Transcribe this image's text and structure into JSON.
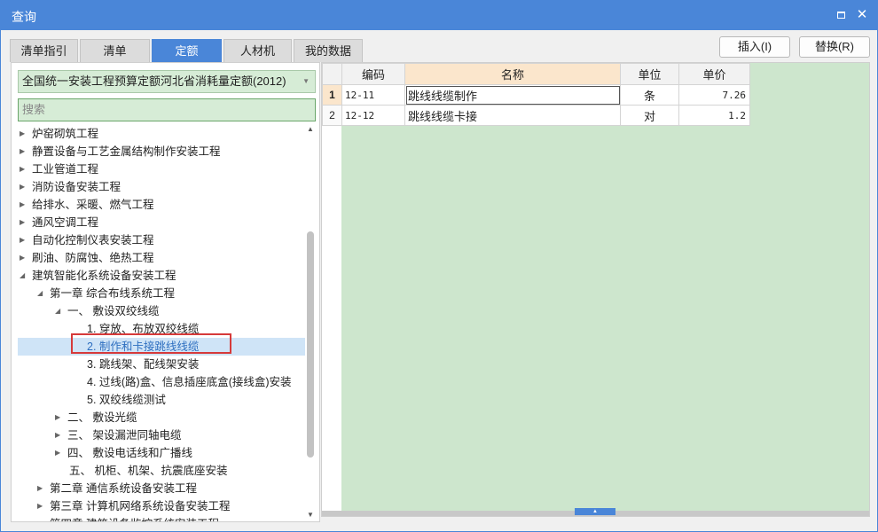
{
  "window": {
    "title": "查询",
    "maximize_icon": "maximize-icon",
    "close_icon": "close-icon"
  },
  "tabs": [
    {
      "label": "清单指引",
      "active": false
    },
    {
      "label": "清单",
      "active": false
    },
    {
      "label": "定额",
      "active": true
    },
    {
      "label": "人材机",
      "active": false
    },
    {
      "label": "我的数据",
      "active": false
    }
  ],
  "actions": {
    "insert": "插入(I)",
    "replace": "替换(R)"
  },
  "left": {
    "library": "全国统一安装工程预算定额河北省消耗量定额(2012)",
    "search_placeholder": "搜索",
    "tree": [
      {
        "label": "炉窑砌筑工程",
        "toggle": "▶"
      },
      {
        "label": "静置设备与工艺金属结构制作安装工程",
        "toggle": "▶"
      },
      {
        "label": "工业管道工程",
        "toggle": "▶"
      },
      {
        "label": "消防设备安装工程",
        "toggle": "▶"
      },
      {
        "label": "给排水、采暖、燃气工程",
        "toggle": "▶"
      },
      {
        "label": "通风空调工程",
        "toggle": "▶"
      },
      {
        "label": "自动化控制仪表安装工程",
        "toggle": "▶"
      },
      {
        "label": "刷油、防腐蚀、绝热工程",
        "toggle": "▶"
      },
      {
        "label": "建筑智能化系统设备安装工程",
        "toggle": "◢"
      },
      {
        "label": "第一章 综合布线系统工程",
        "toggle": "◢"
      },
      {
        "label": "一、 敷设双绞线缆",
        "toggle": "◢"
      },
      {
        "label": "1. 穿放、布放双绞线缆",
        "toggle": ""
      },
      {
        "label": "2. 制作和卡接跳线线缆",
        "toggle": ""
      },
      {
        "label": "3. 跳线架、配线架安装",
        "toggle": ""
      },
      {
        "label": "4. 过线(路)盒、信息插座底盒(接线盒)安装",
        "toggle": ""
      },
      {
        "label": "5. 双绞线缆测试",
        "toggle": ""
      },
      {
        "label": "二、 敷设光缆",
        "toggle": "▶"
      },
      {
        "label": "三、 架设漏泄同轴电缆",
        "toggle": "▶"
      },
      {
        "label": "四、 敷设电话线和广播线",
        "toggle": "▶"
      },
      {
        "label": "五、 机柜、机架、抗震底座安装",
        "toggle": ""
      },
      {
        "label": "第二章 通信系统设备安装工程",
        "toggle": "▶"
      },
      {
        "label": "第三章 计算机网络系统设备安装工程",
        "toggle": "▶"
      },
      {
        "label": "第四章 建筑设备监控系统安装工程",
        "toggle": "▶"
      }
    ],
    "selected_index": 12
  },
  "grid": {
    "columns": {
      "code": "编码",
      "name": "名称",
      "unit": "单位",
      "price": "单价"
    },
    "rows": [
      {
        "no": "1",
        "code": "12-11",
        "name": "跳线线缆制作",
        "unit": "条",
        "price": "7.26"
      },
      {
        "no": "2",
        "code": "12-12",
        "name": "跳线线缆卡接",
        "unit": "对",
        "price": "1.2"
      }
    ],
    "current_row": 0
  }
}
